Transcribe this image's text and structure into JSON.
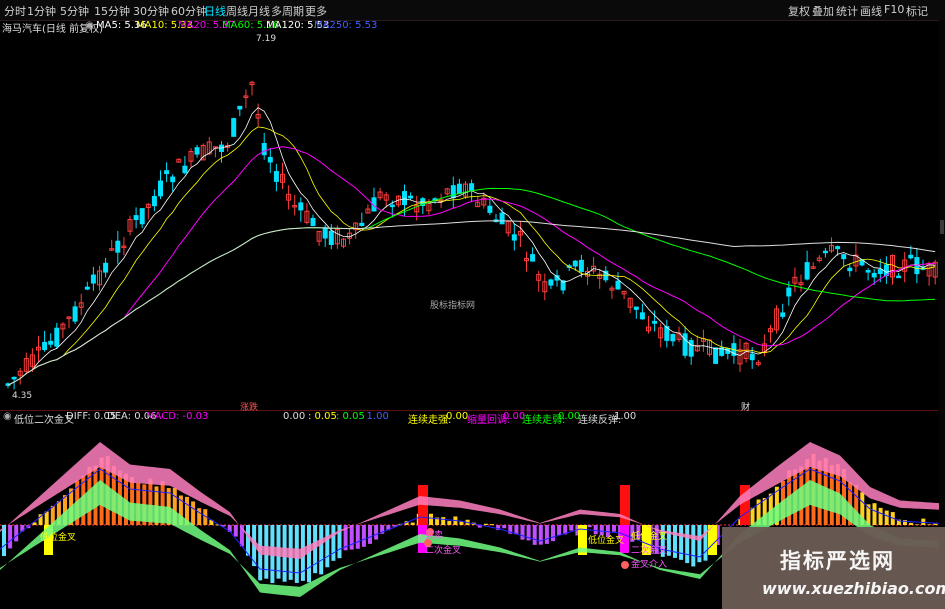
{
  "toolbar": {
    "timeframes": [
      "分时",
      "1分钟",
      "5分钟",
      "15分钟",
      "30分钟",
      "60分钟",
      "日线",
      "周线",
      "月线",
      "多周期",
      "更多"
    ],
    "active_timeframe": "日线",
    "right_buttons": [
      "复权",
      "叠加",
      "统计",
      "画线",
      "F10",
      "标记"
    ],
    "right_icons": [
      "+",
      "-",
      "□"
    ]
  },
  "ma_line": {
    "stock": "海马汽车(日线 前复权)",
    "ma5": "MA5: 5.36",
    "ma10": "MA10: 5.33",
    "ma20": "MA20: 5.37",
    "ma60": "MA60: 5.16",
    "ma120": "MA120: 5.53",
    "ma250": "MA250: 5.53"
  },
  "price_labels": {
    "high": "7.19",
    "low": "4.35",
    "center": "股标指标网",
    "bottom_left": "涨跌",
    "bottom_right": "财"
  },
  "indicator_line": {
    "name": "低位二次金叉",
    "diff": "DIFF: 0.05",
    "dea": "DEA: 0.06",
    "macd": "MACD: -0.03",
    "v1": "0.00",
    "v2": ": 0.05",
    "v3": ": 0.05",
    "v4": ": 1.00",
    "s1_label": "连续走强:",
    "s1": "0.00",
    "s2_label": "缩量回调:",
    "s2": "0.00",
    "s3_label": "连续走弱:",
    "s3": "0.00",
    "s4_label": "连续反弹:",
    "s4": "1.00"
  },
  "indicator_labels": {
    "a": "低位金叉",
    "b": "买卖",
    "c": "二次金叉",
    "d": "低位金叉",
    "e": "低位金叉",
    "f": "二次金叉",
    "g": "金叉介入"
  },
  "watermark": {
    "title": "指标严选网",
    "url": "www.xuezhibiao.com"
  },
  "colors": {
    "up": "#ff3c3c",
    "down": "#00e0ff",
    "ma5": "#ffffff",
    "ma10": "#ffff00",
    "ma20": "#ff00ff",
    "ma60": "#00ff00",
    "ma120": "#ffffff",
    "ma250": "#4040ff"
  }
}
